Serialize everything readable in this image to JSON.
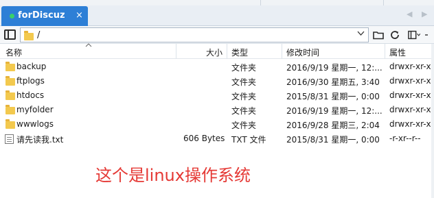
{
  "tabs": [
    {
      "label": "forDiscuz",
      "close": "×",
      "status_color": "#38d16a"
    }
  ],
  "tab_nav": {
    "prev": "◀",
    "next": "▶"
  },
  "address_bar": {
    "path": "/",
    "dropdown_icon": "chevron-down-icon",
    "buttons": [
      "folder-open-icon",
      "refresh-icon",
      "view-options-icon"
    ]
  },
  "columns": {
    "name": "名称",
    "size": "大小",
    "type": "类型",
    "modified": "修改时间",
    "attrs": "属性"
  },
  "files": [
    {
      "name": "backup",
      "size": "",
      "type": "文件夹",
      "modified": "2016/9/19 星期一, 12:...",
      "attrs": "drwxr-xr-x",
      "icon": "folder-icon"
    },
    {
      "name": "ftplogs",
      "size": "",
      "type": "文件夹",
      "modified": "2016/9/30 星期五, 3:40",
      "attrs": "drwxr-xr-x",
      "icon": "folder-icon"
    },
    {
      "name": "htdocs",
      "size": "",
      "type": "文件夹",
      "modified": "2015/8/31 星期一, 0:00",
      "attrs": "drwxr-xr-x",
      "icon": "folder-icon"
    },
    {
      "name": "myfolder",
      "size": "",
      "type": "文件夹",
      "modified": "2016/9/19 星期一, 12:...",
      "attrs": "drwxr-xr-x",
      "icon": "folder-icon"
    },
    {
      "name": "wwwlogs",
      "size": "",
      "type": "文件夹",
      "modified": "2016/9/28 星期三, 2:04",
      "attrs": "drwxr-xr-x",
      "icon": "folder-icon"
    },
    {
      "name": "请先读我.txt",
      "size": "606 Bytes",
      "type": "TXT 文件",
      "modified": "2015/8/31 星期一, 0:00",
      "attrs": "-r-xr--r--",
      "icon": "text-file-icon"
    }
  ],
  "annotation": "这个是linux操作系统",
  "colors": {
    "accent": "#2d7fd6",
    "annotation": "#e53935"
  }
}
